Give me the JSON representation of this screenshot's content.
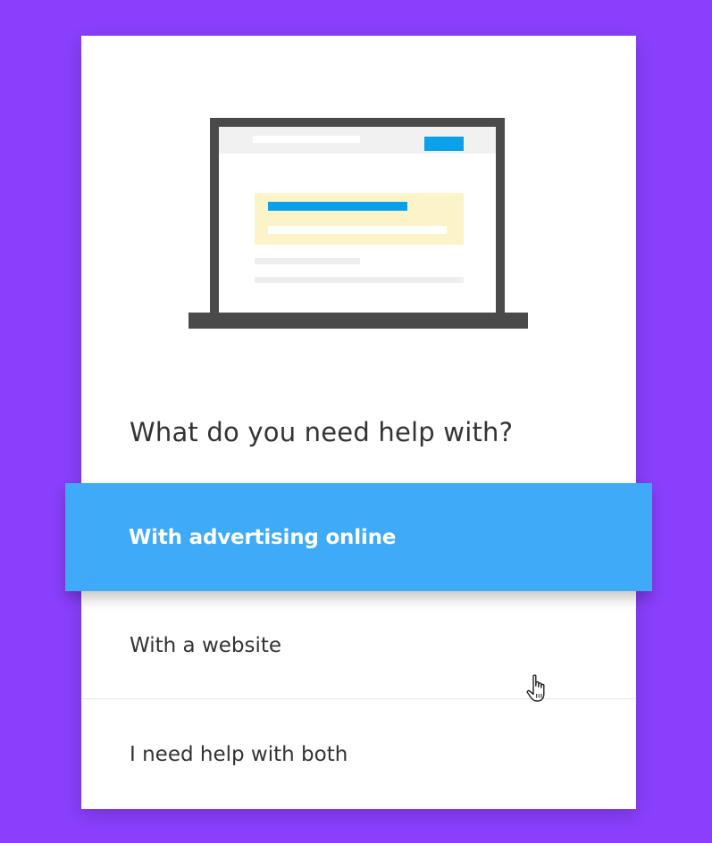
{
  "colors": {
    "background": "#8a3ffc",
    "accent": "#3eaaf8",
    "laptop_frame": "#4a4a4a",
    "card": "#ffffff",
    "highlight_box": "#fdf3c8",
    "content_bar": "#0aa0ea"
  },
  "illustration": {
    "icon": "laptop-icon"
  },
  "question": {
    "text": "What do you need help with?"
  },
  "options": [
    {
      "label": "With advertising online",
      "selected": true
    },
    {
      "label": "With a website",
      "selected": false
    },
    {
      "label": "I need help with both",
      "selected": false
    }
  ],
  "cursor": {
    "icon": "hand-pointer-icon"
  }
}
